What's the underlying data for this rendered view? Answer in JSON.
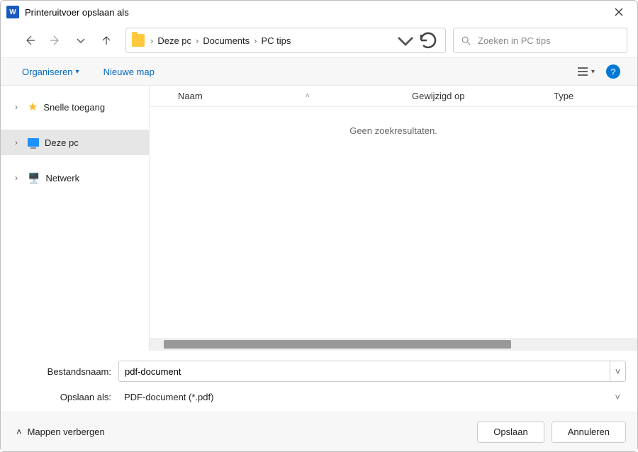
{
  "title": "Printeruitvoer opslaan als",
  "breadcrumb": {
    "root": "Deze pc",
    "mid": "Documents",
    "leaf": "PC tips"
  },
  "search": {
    "placeholder": "Zoeken in PC tips"
  },
  "toolbar": {
    "organize": "Organiseren",
    "new_folder": "Nieuwe map"
  },
  "sidebar": {
    "quick": "Snelle toegang",
    "thispc": "Deze pc",
    "network": "Netwerk"
  },
  "columns": {
    "name": "Naam",
    "modified": "Gewijzigd op",
    "type": "Type"
  },
  "empty_text": "Geen zoekresultaten.",
  "form": {
    "filename_label": "Bestandsnaam:",
    "filename_value": "pdf-document",
    "type_label": "Opslaan als:",
    "type_value": "PDF-document (*.pdf)"
  },
  "actions": {
    "hide_folders": "Mappen verbergen",
    "save": "Opslaan",
    "cancel": "Annuleren"
  }
}
